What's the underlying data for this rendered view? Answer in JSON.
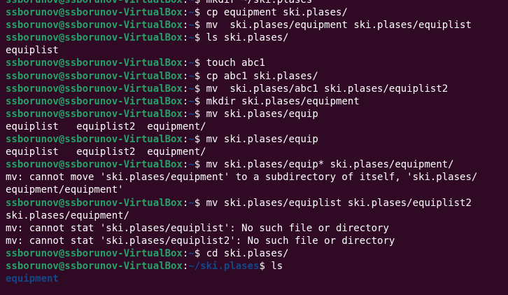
{
  "terminal": {
    "prompt_user_host": "ssborunov@ssborunov-VirtualBox",
    "prompt_path_home": "~",
    "prompt_path_ski": "~/ski.plases",
    "prompt_sep": ":",
    "prompt_dollar": "$ ",
    "lines": [
      {
        "type": "prompt",
        "path": "~",
        "cmd": "mkdir ~/ski.plases"
      },
      {
        "type": "prompt",
        "path": "~",
        "cmd": "cp equipment ski.plases/"
      },
      {
        "type": "prompt",
        "path": "~",
        "cmd": "mv  ski.plases/equipment ski.plases/equiplist"
      },
      {
        "type": "prompt",
        "path": "~",
        "cmd": "ls ski.plases/"
      },
      {
        "type": "output",
        "text": "equiplist"
      },
      {
        "type": "prompt",
        "path": "~",
        "cmd": "touch abc1"
      },
      {
        "type": "prompt",
        "path": "~",
        "cmd": "cp abc1 ski.plases/"
      },
      {
        "type": "prompt",
        "path": "~",
        "cmd": "mv  ski.plases/abc1 ski.plases/equiplist2"
      },
      {
        "type": "prompt",
        "path": "~",
        "cmd": "mkdir ski.plases/equipment"
      },
      {
        "type": "prompt",
        "path": "~",
        "cmd": "mv ski.plases/equip"
      },
      {
        "type": "output",
        "text": "equiplist   equiplist2  equipment/"
      },
      {
        "type": "prompt",
        "path": "~",
        "cmd": "mv ski.plases/equip"
      },
      {
        "type": "output",
        "text": "equiplist   equiplist2  equipment/"
      },
      {
        "type": "prompt",
        "path": "~",
        "cmd": "mv ski.plases/equip* ski.plases/equipment/"
      },
      {
        "type": "output",
        "text": "mv: cannot move 'ski.plases/equipment' to a subdirectory of itself, 'ski.plases/"
      },
      {
        "type": "output",
        "text": "equipment/equipment'"
      },
      {
        "type": "prompt",
        "path": "~",
        "cmd": "mv ski.plases/equiplist ski.plases/equiplist2"
      },
      {
        "type": "output",
        "text": "ski.plases/equipment/"
      },
      {
        "type": "output",
        "text": "mv: cannot stat 'ski.plases/equiplist': No such file or directory"
      },
      {
        "type": "output",
        "text": "mv: cannot stat 'ski.plases/equiplist2': No such file or directory"
      },
      {
        "type": "prompt",
        "path": "~",
        "cmd": "cd ski.plases/"
      },
      {
        "type": "prompt",
        "path": "~/ski.plases",
        "cmd": "ls"
      },
      {
        "type": "dir",
        "text": "equipment"
      }
    ]
  },
  "colors": {
    "background": "#300a24",
    "prompt_user": "#26a269",
    "prompt_path": "#12488b",
    "text": "#ffffff",
    "directory": "#12488b"
  }
}
